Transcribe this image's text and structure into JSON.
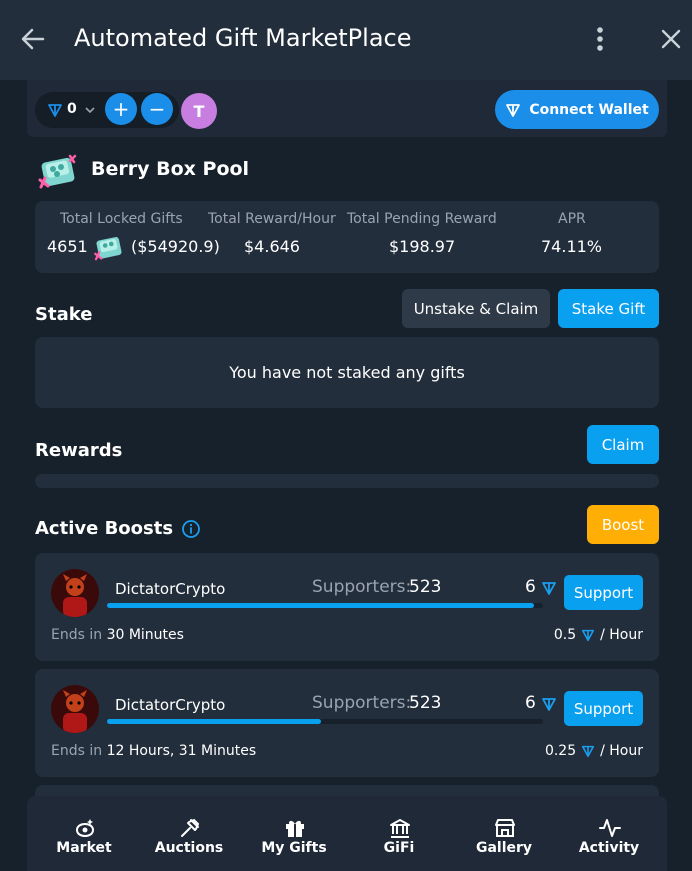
{
  "window": {
    "title": "Automated Gift MarketPlace"
  },
  "wallet": {
    "balance": "0",
    "plus": "+",
    "minus": "−",
    "avatar_letter": "T",
    "connect_label": "Connect Wallet"
  },
  "pool": {
    "title": "Berry Box Pool",
    "stats": [
      {
        "label": "Total Locked Gifts",
        "value": "4651",
        "value_suffix": "($54920.9)"
      },
      {
        "label": "Total Reward/Hour",
        "value": "$4.646"
      },
      {
        "label": "Total Pending Reward",
        "value": "$198.97"
      },
      {
        "label": "APR",
        "value": "74.11%"
      }
    ]
  },
  "stake": {
    "title": "Stake",
    "unstake_label": "Unstake & Claim",
    "stake_label": "Stake Gift",
    "empty_text": "You have not staked any gifts"
  },
  "rewards": {
    "title": "Rewards",
    "claim_label": "Claim"
  },
  "boosts": {
    "title": "Active Boosts",
    "boost_label": "Boost",
    "cards": [
      {
        "name": "DictatorCrypto",
        "supporters_label": "Supporters:",
        "supporters": "523",
        "amount": "6",
        "support_label": "Support",
        "progress": 0.98,
        "ends_label": "Ends in",
        "ends_value": "30 Minutes",
        "rate": "0.5",
        "rate_unit": "/ Hour"
      },
      {
        "name": "DictatorCrypto",
        "supporters_label": "Supporters:",
        "supporters": "523",
        "amount": "6",
        "support_label": "Support",
        "progress": 0.49,
        "ends_label": "Ends in",
        "ends_value": "12 Hours, 31 Minutes",
        "rate": "0.25",
        "rate_unit": "/ Hour"
      }
    ]
  },
  "nav": [
    {
      "label": "Market",
      "icon": "market-icon"
    },
    {
      "label": "Auctions",
      "icon": "gavel-icon"
    },
    {
      "label": "My Gifts",
      "icon": "gift-icon"
    },
    {
      "label": "GiFi",
      "icon": "bank-icon"
    },
    {
      "label": "Gallery",
      "icon": "store-icon"
    },
    {
      "label": "Activity",
      "icon": "activity-icon"
    }
  ],
  "colors": {
    "accent": "#0aa0f0",
    "boost": "#ffae06",
    "bg": "#17212b",
    "card": "#232e3c"
  }
}
